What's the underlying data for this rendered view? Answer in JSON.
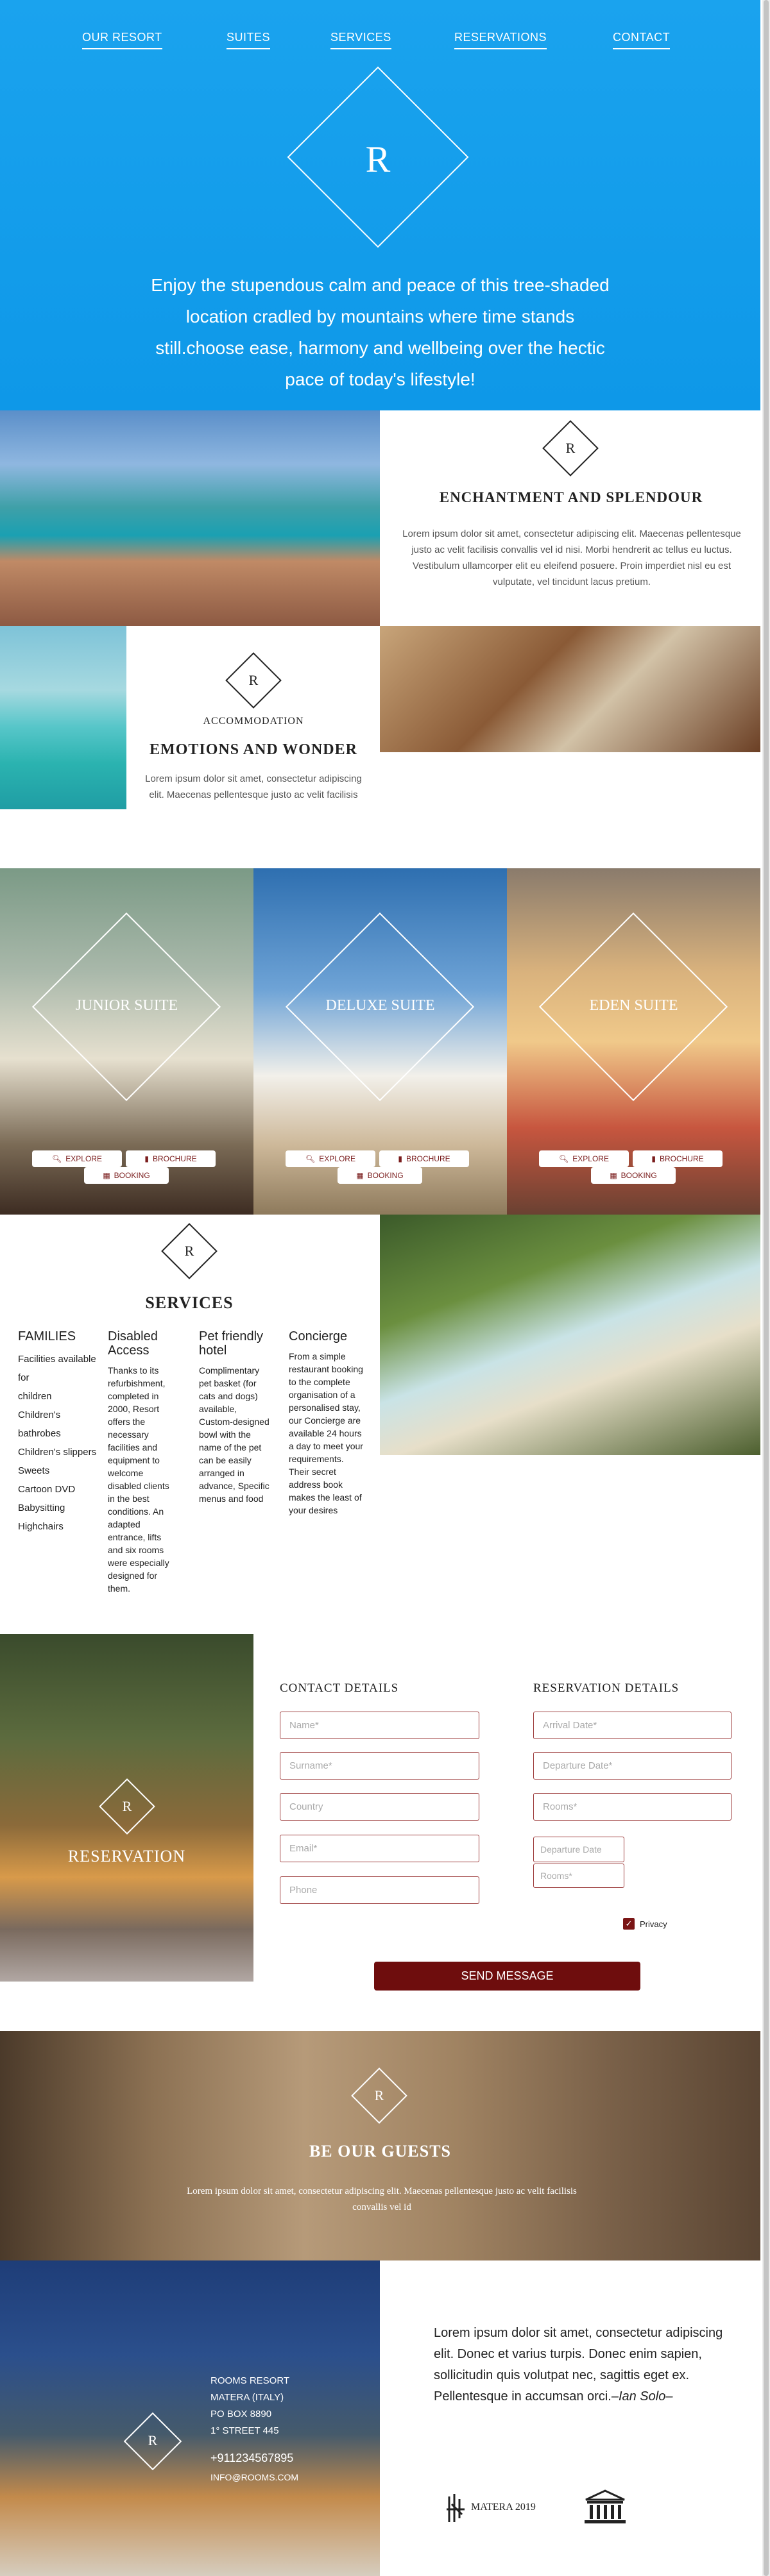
{
  "nav": {
    "items": [
      "OUR RESORT",
      "SUITES",
      "SERVICES",
      "RESERVATIONS",
      "CONTACT"
    ]
  },
  "hero": {
    "logo_letter": "R",
    "text": "Enjoy the stupendous calm and peace of this tree-shaded location cradled by mountains where time stands still.choose ease, harmony and wellbeing over the hectic pace of today's lifestyle!"
  },
  "enchantment": {
    "logo_letter": "R",
    "title": "ENCHANTMENT AND SPLENDOUR",
    "text": "Lorem ipsum dolor sit amet, consectetur adipiscing elit. Maecenas pellentesque justo ac velit facilisis convallis vel id nisi. Morbi hendrerit ac tellus eu luctus. Vestibulum ullamcorper elit eu eleifend posuere. Proin imperdiet nisl eu est vulputate, vel tincidunt lacus pretium."
  },
  "accommodation": {
    "logo_letter": "R",
    "label": "ACCOMMODATION",
    "title": "EMOTIONS AND WONDER",
    "text": "Lorem ipsum dolor sit amet, consectetur adipiscing elit. Maecenas pellentesque justo ac velit facilisis"
  },
  "suites": [
    {
      "name": "JUNIOR SUITE",
      "explore": "EXPLORE",
      "brochure": "BROCHURE",
      "booking": "BOOKING"
    },
    {
      "name": "DELUXE SUITE",
      "explore": "EXPLORE",
      "brochure": "BROCHURE",
      "booking": "BOOKING"
    },
    {
      "name": "EDEN SUITE",
      "explore": "EXPLORE",
      "brochure": "BROCHURE",
      "booking": "BOOKING"
    }
  ],
  "services": {
    "logo_letter": "R",
    "title": "SERVICES",
    "columns": [
      {
        "heading": "FAMILIES",
        "items": [
          "Facilities available for",
          "children",
          "Children's bathrobes",
          "Children's slippers",
          "Sweets",
          "Cartoon DVD",
          "Babysitting",
          "Highchairs"
        ]
      },
      {
        "heading": "Disabled Access",
        "text": "Thanks to its refurbishment, completed in 2000, Resort offers the necessary facilities and equipment to welcome disabled clients in the best conditions. An adapted entrance, lifts and six rooms were especially designed for them."
      },
      {
        "heading": "Pet friendly hotel",
        "text": "Complimentary pet basket (for cats and dogs) available, Custom-designed bowl with the name of the pet can be easily arranged in advance, Specific menus and food"
      },
      {
        "heading": "Concierge",
        "text": "From a simple restaurant booking to the complete organisation of a personalised stay, our Concierge are available 24 hours a day to meet your requirements. Their secret address book makes the least of your desires"
      }
    ]
  },
  "reservation": {
    "logo_letter": "R",
    "title": "RESERVATION",
    "contact_heading": "CONTACT DETAILS",
    "reservation_heading": "RESERVATION DETAILS",
    "contact_fields": [
      "Name*",
      "Surname*",
      "Country",
      "Email*",
      "Phone"
    ],
    "reservation_fields": [
      "Arrival Date*",
      "Departure Date*",
      "Rooms*"
    ],
    "small_fields": [
      "Departure Date",
      "Rooms*"
    ],
    "privacy_label": "Privacy",
    "send_label": "SEND MESSAGE"
  },
  "guests": {
    "logo_letter": "R",
    "title": "BE OUR GUESTS",
    "text": "Lorem ipsum dolor sit amet, consectetur adipiscing elit. Maecenas pellentesque justo ac velit facilisis convallis vel id"
  },
  "footer": {
    "logo_letter": "R",
    "address": [
      "ROOMS RESORT",
      "MATERA (ITALY)",
      "PO BOX 8890",
      "1° STREET 445"
    ],
    "phone": "+911234567895",
    "email": "INFO@ROOMS.COM",
    "quote": "Lorem ipsum dolor sit amet, consectetur adipiscing elit. Donec et varius turpis. Donec enim sapien, sollicitudin quis volutpat nec, sagittis eget ex. Pellentesque in accumsan orci.",
    "quote_author": "–Ian Solo–",
    "badge_matera": "MATERA 2019",
    "badge_unesco": "UNESCO"
  },
  "colors": {
    "hero_blue": "#1aa3ee",
    "accent_maroon": "#6e0d0d",
    "field_border": "#9c3a3a"
  }
}
